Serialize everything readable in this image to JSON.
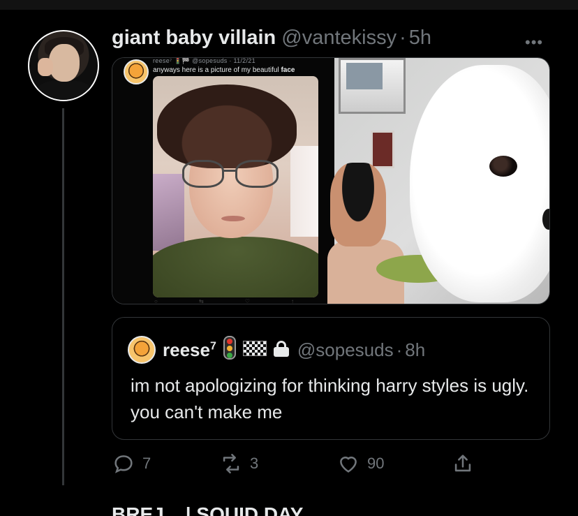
{
  "tweet": {
    "display_name": "giant baby villain",
    "handle": "@vantekissy",
    "separator": "·",
    "time": "5h",
    "more_icon": "more-horizontal-icon"
  },
  "media": {
    "embedded_post": {
      "meta": "reese⁷ 🚦🏁 @sopesuds · 11/2/21",
      "text_prefix": "anyways here is a picture of my beautiful",
      "text_bold": "face"
    }
  },
  "quote": {
    "display_name": "reese",
    "superscript": "7",
    "handle": "@sopesuds",
    "separator": "·",
    "time": "8h",
    "text": "im not apologizing for thinking harry styles is ugly. you can't make me"
  },
  "actions": {
    "reply_count": "7",
    "retweet_count": "3",
    "like_count": "90"
  },
  "next_tweet": {
    "partial_text": "BREJ...        | SQUID DAY"
  },
  "colors": {
    "background": "#000000",
    "text_primary": "#e7e9ea",
    "text_secondary": "#71767b",
    "border": "#333639"
  }
}
